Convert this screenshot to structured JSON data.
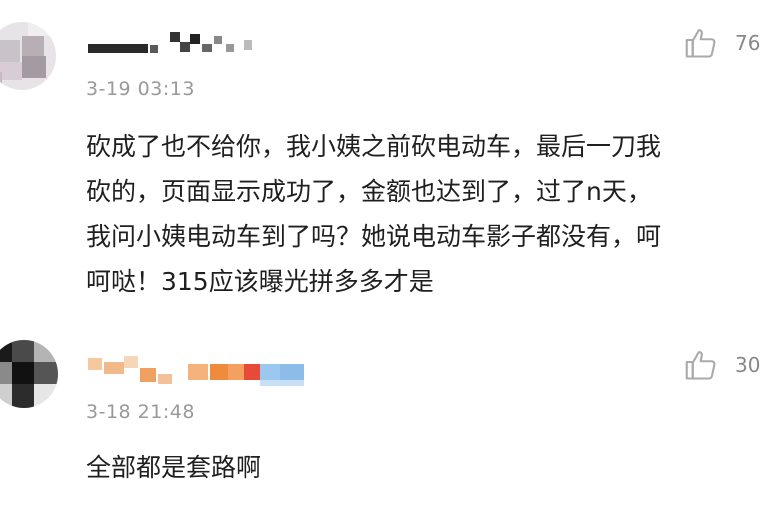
{
  "comments": [
    {
      "timestamp": "3-19 03:13",
      "like_count": "76",
      "body_lines": [
        "砍成了也不给你，我小姨之前砍电动车，最后一刀我",
        "砍的，页面显示成功了，金额也达到了，过了n天，",
        "我问小姨电动车到了吗？她说电动车影子都没有，呵",
        "呵哒！315应该曝光拼多多才是"
      ]
    },
    {
      "timestamp": "3-18 21:48",
      "like_count": "30",
      "body_lines": [
        "全部都是套路啊"
      ]
    }
  ],
  "icons": {
    "like": "thumbs-up-icon"
  },
  "colors": {
    "timestamp": "#999999",
    "body_text": "#1f1f1f",
    "like_icon": "#aaaaaa"
  }
}
